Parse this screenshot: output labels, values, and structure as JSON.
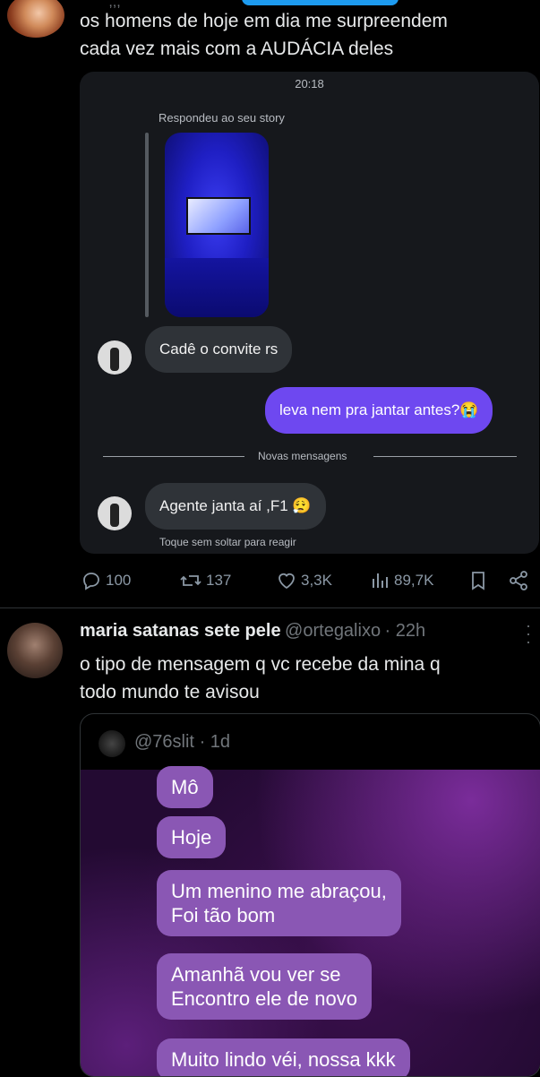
{
  "tweet1": {
    "text_line1": "os homens de hoje em dia me surpreendem",
    "text_line2": "cada vez mais com a AUDÁCIA deles",
    "dm": {
      "time": "20:18",
      "replied_label": "Respondeu ao seu story",
      "msg1": "Cadê o convite rs",
      "msg2": "leva nem pra jantar antes?😭",
      "new_messages": "Novas mensagens",
      "msg3": "Agente janta aí ,F1 😮‍💨",
      "hint": "Toque sem soltar para reagir"
    },
    "actions": {
      "replies": "100",
      "reposts": "137",
      "likes": "3,3K",
      "views": "89,7K"
    }
  },
  "tweet2": {
    "name": "maria satanas sete pele",
    "handle": "@ortegalixo",
    "time": "· 22h",
    "text_line1": "o tipo de mensagem q vc recebe da mina q",
    "text_line2": "todo mundo te avisou",
    "quote": {
      "handle": "@76slit",
      "time": "· 1d",
      "messages": [
        "Mô",
        "Hoje",
        "Um menino me abraçou,",
        "Foi tão bom",
        "Amanhã vou ver se",
        "Encontro ele de novo",
        "Muito lindo véi, nossa kkk"
      ]
    }
  },
  "icons": [
    "reply-icon",
    "repost-icon",
    "like-icon",
    "views-icon",
    "bookmark-icon",
    "share-icon",
    "more-icon"
  ],
  "colors": {
    "accent": "#1d9bf0",
    "dm_out_bubble": "#6e48f0",
    "dm_in_bubble": "#2f3338",
    "quote_bubble": "#8a57b4"
  }
}
